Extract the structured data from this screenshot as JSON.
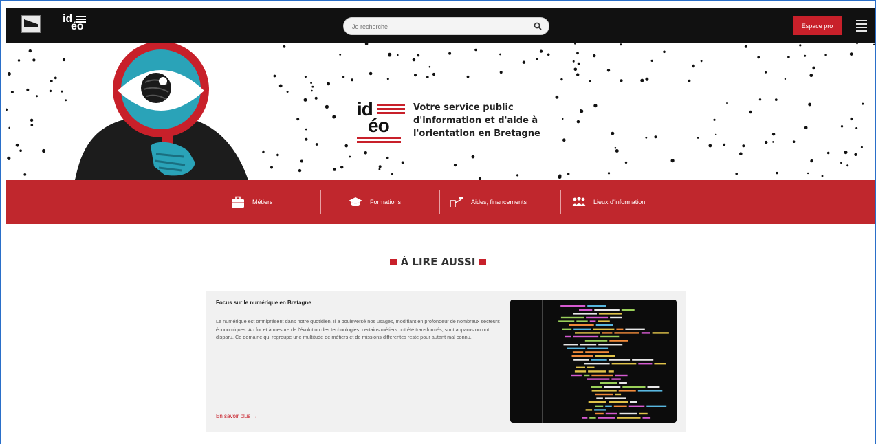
{
  "header": {
    "search_placeholder": "Je recherche",
    "espace_pro_label": "Espace pro"
  },
  "hero": {
    "logo_id": "id",
    "logo_eo": "éo",
    "tagline": [
      "Votre service public",
      "d'information et d'aide à",
      "l'orientation en Bretagne"
    ]
  },
  "nav": {
    "items": [
      {
        "label": "Métiers",
        "icon": "briefcase-icon"
      },
      {
        "label": "Formations",
        "icon": "graduation-cap-icon"
      },
      {
        "label": "Aides, financements",
        "icon": "hand-money-icon"
      },
      {
        "label": "Lieux d'information",
        "icon": "people-group-icon"
      }
    ]
  },
  "section": {
    "title": "À LIRE AUSSI"
  },
  "card": {
    "title": "Focus sur le numérique en Bretagne",
    "text": "Le numérique est omniprésent dans notre quotidien. Il a bouleversé nos usages, modifiant en profondeur de nombreux secteurs économiques. Au fur et à mesure de l'évolution des technologies, certains métiers ont été transformés, sont apparus ou ont disparu. Ce domaine qui regroupe une multitude de métiers et de missions différentes reste pour autant mal connu.",
    "link": "En savoir plus"
  },
  "colors": {
    "brand_red": "#c0272d",
    "topbar": "#111111",
    "mascot_teal": "#2aa3b8"
  }
}
